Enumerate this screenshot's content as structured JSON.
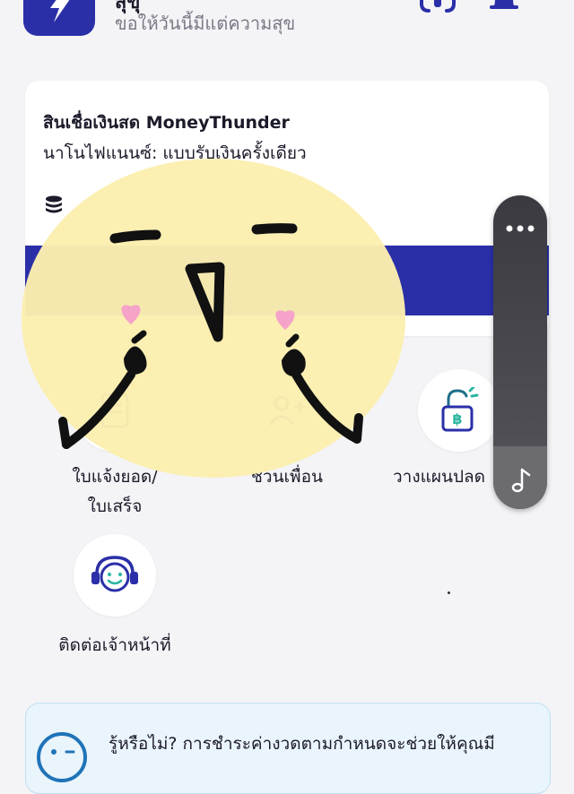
{
  "header": {
    "title": "สุขุ",
    "greeting": "ขอให้วันนี้มีแต่ความสุข",
    "icons": [
      "app-logo-icon",
      "headset-icon",
      "bell-icon"
    ]
  },
  "loan_card": {
    "title": "สินเชื่อเงินสด MoneyThunder",
    "subtitle": "นาโนไฟแนนซ์: แบบรับเงินครั้งเดียว",
    "icon": "database-icon",
    "cta_color": "#2a2fa8"
  },
  "menu": {
    "items": [
      {
        "label_line1": "ใบแจ้งยอด/",
        "label_line2": "ใบเสร็จ"
      },
      {
        "label_line1": "ชวนเพื่อน"
      },
      {
        "label_line1": "วางแผนปลด"
      },
      {
        "label_line1": "ติดต่อเจ้าหน้าที่"
      }
    ]
  },
  "tip": {
    "text": "รู้หรือไม่? การชำระค่างวดตามกำหนดจะช่วยให้คุณมี"
  },
  "colors": {
    "brand": "#2a2fa8",
    "background": "#f4f4f7",
    "sticker_face": "#fbeeb0"
  }
}
